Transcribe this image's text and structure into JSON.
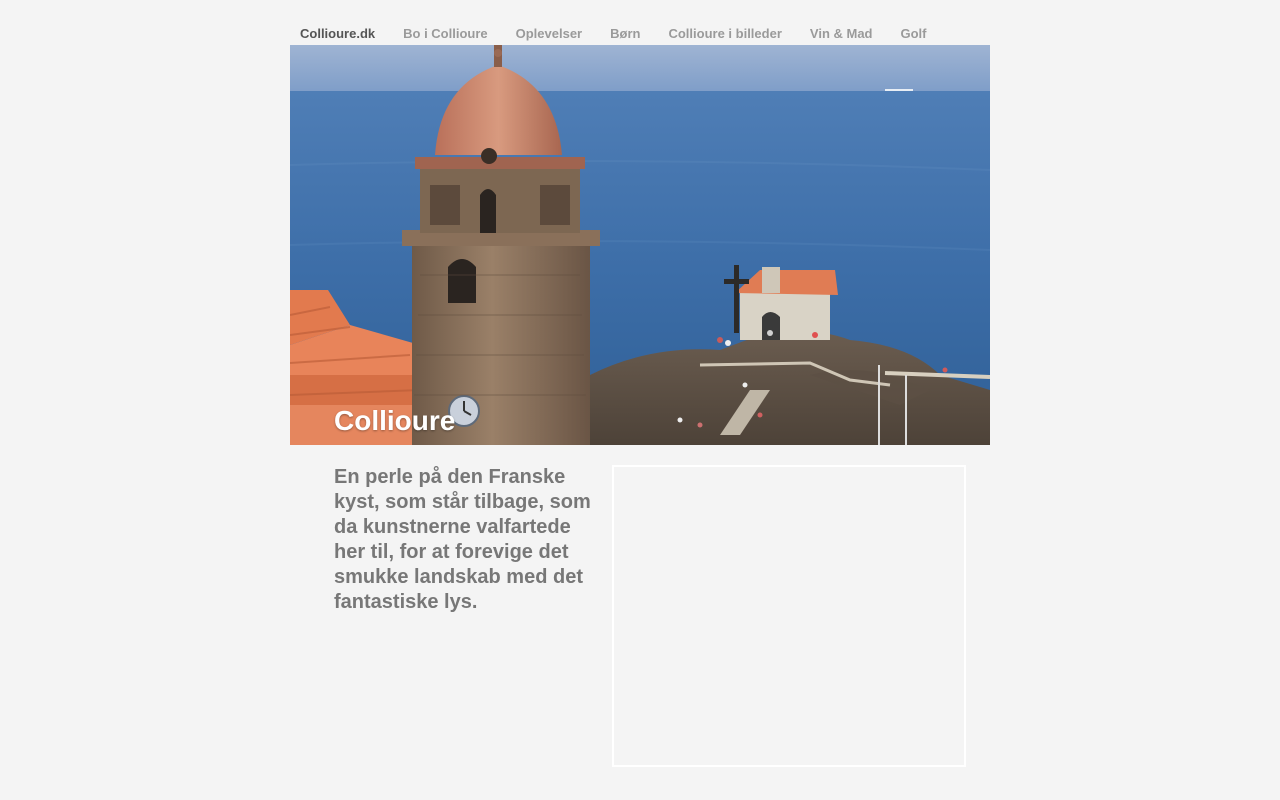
{
  "nav": {
    "items": [
      {
        "label": "Collioure.dk",
        "active": true
      },
      {
        "label": "Bo i Collioure",
        "active": false
      },
      {
        "label": "Oplevelser",
        "active": false
      },
      {
        "label": "Børn",
        "active": false
      },
      {
        "label": "Collioure i billeder",
        "active": false
      },
      {
        "label": "Vin & Mad",
        "active": false
      },
      {
        "label": "Golf",
        "active": false
      }
    ]
  },
  "hero": {
    "title": "Collioure",
    "image": "collioure-bell-tower-and-chapel-photo"
  },
  "intro": {
    "text": "En perle på den Franske kyst, som står tilbage, som da kunstnerne valfartede her til, for at forevige det smukke landskab med det fantastiske lys."
  },
  "media": {
    "placeholder": "empty-media-frame"
  },
  "colors": {
    "background": "#f4f4f4",
    "nav_text": "#9a9a9a",
    "nav_active": "#555555",
    "body_text": "#777777",
    "title_text": "#ffffff"
  }
}
